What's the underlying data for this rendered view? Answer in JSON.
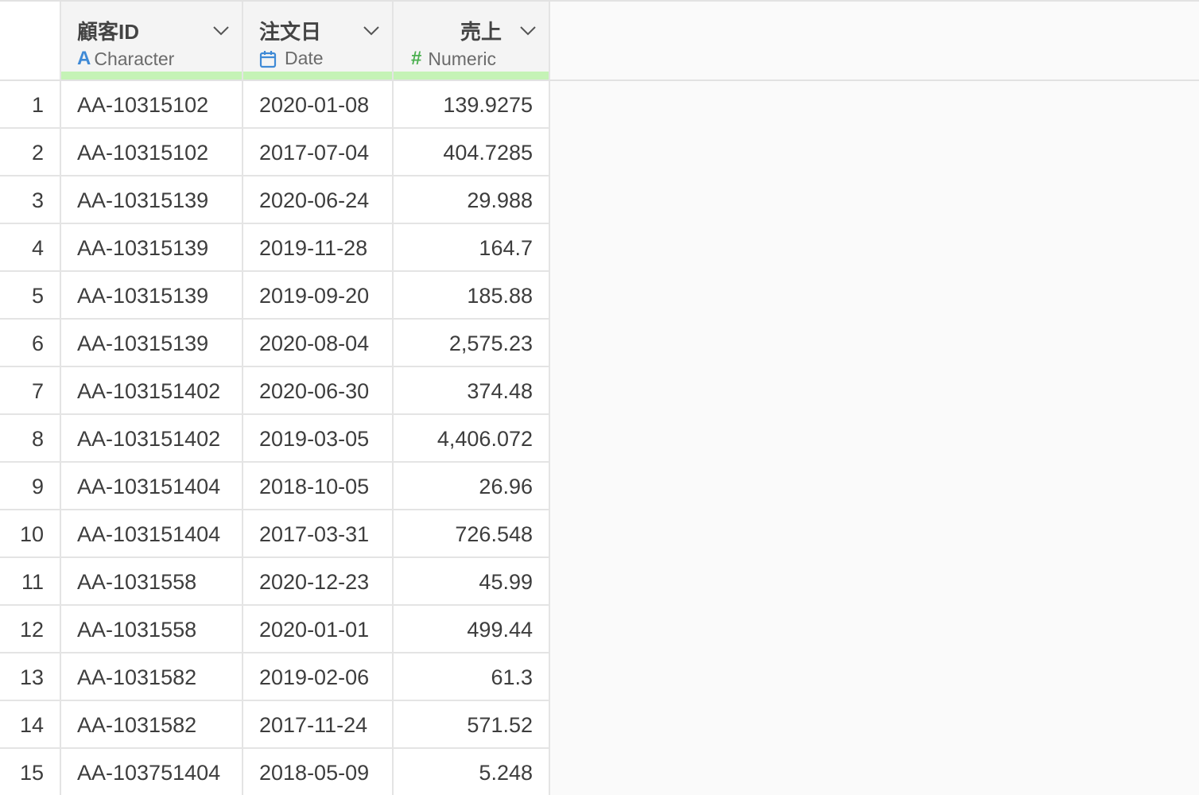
{
  "columns": [
    {
      "title": "顧客ID",
      "type_label": "Character",
      "type_icon": "character-type-icon"
    },
    {
      "title": "注文日",
      "type_label": "Date",
      "type_icon": "calendar-icon"
    },
    {
      "title": "売上",
      "type_label": "Numeric",
      "type_icon": "hash-icon"
    }
  ],
  "colors": {
    "character_icon": "#3f8ad6",
    "date_icon": "#3f8ad6",
    "numeric_icon": "#4cb050",
    "quality_bar": "#c5f3b6"
  },
  "rows": [
    {
      "num": "1",
      "id": "AA-10315102",
      "date": "2020-01-08",
      "sales": "139.9275"
    },
    {
      "num": "2",
      "id": "AA-10315102",
      "date": "2017-07-04",
      "sales": "404.7285"
    },
    {
      "num": "3",
      "id": "AA-10315139",
      "date": "2020-06-24",
      "sales": "29.988"
    },
    {
      "num": "4",
      "id": "AA-10315139",
      "date": "2019-11-28",
      "sales": "164.7"
    },
    {
      "num": "5",
      "id": "AA-10315139",
      "date": "2019-09-20",
      "sales": "185.88"
    },
    {
      "num": "6",
      "id": "AA-10315139",
      "date": "2020-08-04",
      "sales": "2,575.23"
    },
    {
      "num": "7",
      "id": "AA-103151402",
      "date": "2020-06-30",
      "sales": "374.48"
    },
    {
      "num": "8",
      "id": "AA-103151402",
      "date": "2019-03-05",
      "sales": "4,406.072"
    },
    {
      "num": "9",
      "id": "AA-103151404",
      "date": "2018-10-05",
      "sales": "26.96"
    },
    {
      "num": "10",
      "id": "AA-103151404",
      "date": "2017-03-31",
      "sales": "726.548"
    },
    {
      "num": "11",
      "id": "AA-1031558",
      "date": "2020-12-23",
      "sales": "45.99"
    },
    {
      "num": "12",
      "id": "AA-1031558",
      "date": "2020-01-01",
      "sales": "499.44"
    },
    {
      "num": "13",
      "id": "AA-1031582",
      "date": "2019-02-06",
      "sales": "61.3"
    },
    {
      "num": "14",
      "id": "AA-1031582",
      "date": "2017-11-24",
      "sales": "571.52"
    },
    {
      "num": "15",
      "id": "AA-103751404",
      "date": "2018-05-09",
      "sales": "5.248"
    }
  ]
}
